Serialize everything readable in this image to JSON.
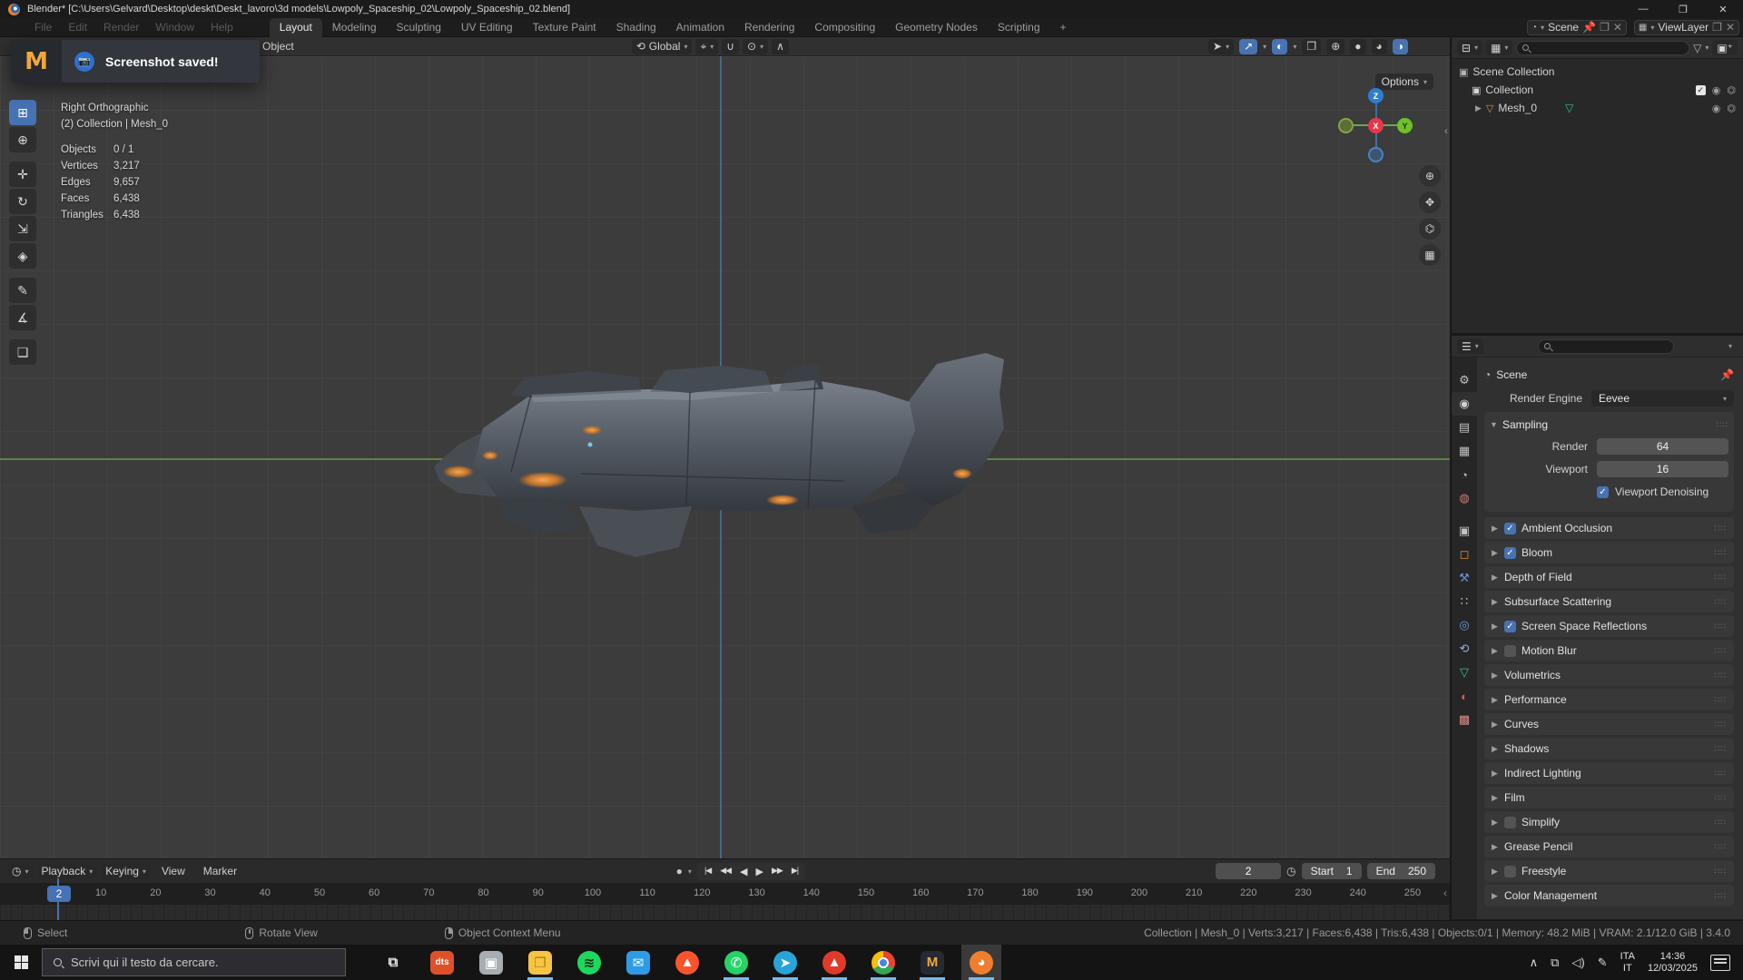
{
  "window": {
    "title": "Blender* [C:\\Users\\Gelvard\\Desktop\\deskt\\Deskt_lavoro\\3d models\\Lowpoly_Spaceship_02\\Lowpoly_Spaceship_02.blend]",
    "controls": {
      "minimize": "—",
      "maximize": "❐",
      "close": "✕"
    }
  },
  "topbar": {
    "menus": [
      {
        "label": "File"
      },
      {
        "label": "Edit"
      },
      {
        "label": "Render"
      },
      {
        "label": "Window"
      },
      {
        "label": "Help"
      }
    ],
    "tabs": [
      {
        "label": "Layout",
        "active": true
      },
      {
        "label": "Modeling"
      },
      {
        "label": "Sculpting"
      },
      {
        "label": "UV Editing"
      },
      {
        "label": "Texture Paint"
      },
      {
        "label": "Shading"
      },
      {
        "label": "Animation"
      },
      {
        "label": "Rendering"
      },
      {
        "label": "Compositing"
      },
      {
        "label": "Geometry Nodes"
      },
      {
        "label": "Scripting"
      },
      {
        "label": "+"
      }
    ],
    "scene_selector": {
      "value": "Scene"
    },
    "view_layer_selector": {
      "value": "ViewLayer"
    }
  },
  "toast": {
    "app_initial": "M",
    "message": "Screenshot saved!"
  },
  "viewport": {
    "header": {
      "mode": "Object",
      "orientation": "Global",
      "options_label": "Options"
    },
    "overlay": {
      "view_name": "Right Orthographic",
      "context": "(2) Collection | Mesh_0",
      "stats": [
        {
          "label": "Objects",
          "value": "0 / 1"
        },
        {
          "label": "Vertices",
          "value": "3,217"
        },
        {
          "label": "Edges",
          "value": "9,657"
        },
        {
          "label": "Faces",
          "value": "6,438"
        },
        {
          "label": "Triangles",
          "value": "6,438"
        }
      ]
    },
    "tools": [
      {
        "name": "select-box",
        "glyph": "⊞",
        "active": true
      },
      {
        "name": "cursor",
        "glyph": "⊕"
      },
      {
        "name": "move",
        "glyph": "✛",
        "gap": true
      },
      {
        "name": "rotate",
        "glyph": "↻"
      },
      {
        "name": "scale",
        "glyph": "⇲"
      },
      {
        "name": "transform",
        "glyph": "◈"
      },
      {
        "name": "annotate",
        "glyph": "✎",
        "gap": true
      },
      {
        "name": "measure",
        "glyph": "∡"
      },
      {
        "name": "add-cube",
        "glyph": "❏",
        "gap": true
      }
    ],
    "gizmo": {
      "x": "X",
      "y": "Y",
      "z": "Z"
    },
    "nav_buttons": [
      {
        "name": "zoom",
        "glyph": "⊕"
      },
      {
        "name": "pan-hand",
        "glyph": "✋"
      },
      {
        "name": "camera-view",
        "glyph": "🎥"
      },
      {
        "name": "ortho-grid",
        "glyph": "▦"
      }
    ]
  },
  "outliner": {
    "rows": {
      "scene_collection": "Scene Collection",
      "collection": "Collection",
      "mesh": "Mesh_0"
    }
  },
  "properties": {
    "breadcrumb": "Scene",
    "render_engine": {
      "label": "Render Engine",
      "value": "Eevee"
    },
    "sampling": {
      "title": "Sampling",
      "rows": [
        {
          "label": "Render",
          "value": "64"
        },
        {
          "label": "Viewport",
          "value": "16"
        }
      ],
      "checkbox_label": "Viewport Denoising",
      "checkbox_checked": true
    },
    "sections": [
      {
        "label": "Ambient Occlusion",
        "check": "on"
      },
      {
        "label": "Bloom",
        "check": "on"
      },
      {
        "label": "Depth of Field",
        "check": "none"
      },
      {
        "label": "Subsurface Scattering",
        "check": "none"
      },
      {
        "label": "Screen Space Reflections",
        "check": "on"
      },
      {
        "label": "Motion Blur",
        "check": "off"
      },
      {
        "label": "Volumetrics",
        "check": "none"
      },
      {
        "label": "Performance",
        "check": "none"
      },
      {
        "label": "Curves",
        "check": "none"
      },
      {
        "label": "Shadows",
        "check": "none"
      },
      {
        "label": "Indirect Lighting",
        "check": "none"
      },
      {
        "label": "Film",
        "check": "none"
      },
      {
        "label": "Simplify",
        "check": "off"
      },
      {
        "label": "Grease Pencil",
        "check": "none"
      },
      {
        "label": "Freestyle",
        "check": "off"
      },
      {
        "label": "Color Management",
        "check": "none"
      }
    ],
    "tabs": [
      {
        "name": "tool",
        "glyph": "⚙",
        "color": "#c2c2c2"
      },
      {
        "name": "render",
        "glyph": "◉",
        "color": "#d0d0d0",
        "active": true
      },
      {
        "name": "output",
        "glyph": "▤",
        "color": "#c2c2c2"
      },
      {
        "name": "view-layer",
        "glyph": "▦",
        "color": "#c2c2c2"
      },
      {
        "name": "scene",
        "glyph": "◔",
        "color": "#c2c2c2"
      },
      {
        "name": "world",
        "glyph": "◍",
        "color": "#d07a7a"
      },
      {
        "name": "collection",
        "glyph": "▣",
        "color": "#c2c2c2",
        "gap": true
      },
      {
        "name": "object",
        "glyph": "◻",
        "color": "#e0883c"
      },
      {
        "name": "modifiers",
        "glyph": "⚒",
        "color": "#6b8fd6"
      },
      {
        "name": "particles",
        "glyph": "∷",
        "color": "#c2c2c2"
      },
      {
        "name": "physics",
        "glyph": "◎",
        "color": "#6b9fd8"
      },
      {
        "name": "constraints",
        "glyph": "⟲",
        "color": "#8fb3e0"
      },
      {
        "name": "data",
        "glyph": "▽",
        "color": "#3cc08c"
      },
      {
        "name": "material",
        "glyph": "◐",
        "color": "#d45a5a"
      },
      {
        "name": "texture",
        "glyph": "▩",
        "color": "#d48a8a"
      }
    ]
  },
  "timeline": {
    "menus": [
      {
        "label": "Playback"
      },
      {
        "label": "Keying"
      },
      {
        "label": "View"
      },
      {
        "label": "Marker"
      }
    ],
    "transport": [
      {
        "name": "jump-start",
        "glyph": "|◀"
      },
      {
        "name": "prev-keyframe",
        "glyph": "◀◀"
      },
      {
        "name": "play-reverse",
        "glyph": "◀",
        "play": true
      },
      {
        "name": "play",
        "glyph": "▶",
        "play": true
      },
      {
        "name": "next-keyframe",
        "glyph": "▶▶"
      },
      {
        "name": "jump-end",
        "glyph": "▶|"
      }
    ],
    "current_frame": "2",
    "start": {
      "label": "Start",
      "value": "1"
    },
    "end": {
      "label": "End",
      "value": "250"
    },
    "ticks": [
      10,
      20,
      30,
      40,
      50,
      60,
      70,
      80,
      90,
      100,
      110,
      120,
      130,
      140,
      150,
      160,
      170,
      180,
      190,
      200,
      210,
      220,
      230,
      240,
      250
    ]
  },
  "statusbar": {
    "hints": [
      {
        "label": "Select",
        "btn": "l"
      },
      {
        "label": "Rotate View",
        "btn": "m"
      },
      {
        "label": "Object Context Menu",
        "btn": "r"
      }
    ],
    "info": "Collection | Mesh_0 | Verts:3,217 | Faces:6,438 | Tris:6,438 | Objects:0/1 | Memory: 48.2 MiB | VRAM: 2.1/12.0 GiB | 3.4.0"
  },
  "taskbar": {
    "search_placeholder": "Scrivi qui il testo da cercare.",
    "apps": [
      {
        "name": "task-view",
        "glyph": "⧉",
        "bg": "transparent",
        "fg": "#e8e8e8"
      },
      {
        "name": "dts",
        "glyph": "dts",
        "bg": "#e0502a",
        "fg": "#ffffff",
        "small": true
      },
      {
        "name": "installer",
        "glyph": "▣",
        "bg": "#a8adb3",
        "fg": "#ffffff"
      },
      {
        "name": "file-explorer",
        "glyph": "❒",
        "bg": "#f6c444",
        "fg": "#b07910",
        "running": true
      },
      {
        "name": "spotify",
        "glyph": "≋",
        "bg": "#1ed760",
        "fg": "#0d2b14",
        "round": true
      },
      {
        "name": "mail",
        "glyph": "✉",
        "bg": "#2e9be6",
        "fg": "#ffffff"
      },
      {
        "name": "brave",
        "glyph": "▲",
        "bg": "#fb542b",
        "fg": "#ffffff",
        "round": true
      },
      {
        "name": "whatsapp",
        "glyph": "✆",
        "bg": "#25d366",
        "fg": "#ffffff",
        "round": true,
        "running": true
      },
      {
        "name": "telegram",
        "glyph": "➤",
        "bg": "#2aa4d8",
        "fg": "#ffffff",
        "round": true,
        "running": true
      },
      {
        "name": "brave-profile",
        "glyph": "▲",
        "bg": "#e03a2a",
        "fg": "#ffffff",
        "round": true,
        "running": true
      },
      {
        "name": "chrome",
        "glyph": "◉",
        "bg": "conic",
        "fg": "#ffffff",
        "round": true,
        "running": true
      },
      {
        "name": "gmail",
        "glyph": "M",
        "bg": "#262a33",
        "fg": "#f2a73b",
        "running": true
      },
      {
        "name": "blender",
        "glyph": "◕",
        "bg": "#ef7f2e",
        "fg": "#ffffff",
        "round": true,
        "running": true,
        "active": true
      }
    ],
    "tray": {
      "chevron": "∧",
      "display_icon": "🖵",
      "volume_icon": "🔊",
      "pen_icon": "✎",
      "lang_top": "ITA",
      "lang_bottom": "IT",
      "time": "14:36",
      "date": "12/03/2025"
    }
  }
}
